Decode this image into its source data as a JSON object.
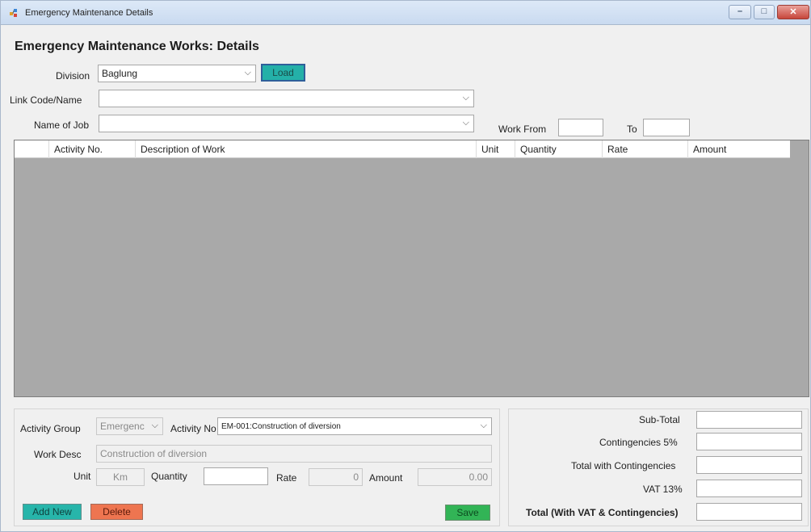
{
  "window": {
    "title": "Emergency Maintenance Details",
    "min_label": "–",
    "max_label": "□",
    "close_label": "✕"
  },
  "form": {
    "heading": "Emergency Maintenance Works: Details",
    "division_label": "Division",
    "division_value": "Baglung",
    "load_label": "Load",
    "link_label": "Link Code/Name",
    "link_value": "",
    "job_label": "Name of Job",
    "job_value": "",
    "work_from_label": "Work From",
    "work_from_value": "",
    "to_label": "To",
    "to_value": ""
  },
  "grid": {
    "columns": [
      "",
      "Activity No.",
      "Description of Work",
      "Unit",
      "Quantity",
      "Rate",
      "Amount"
    ]
  },
  "activity": {
    "group_label": "Activity Group",
    "group_value": "Emergenc",
    "activity_no_label": "Activity No",
    "activity_no_value": "EM-001:Construction of diversion",
    "work_desc_label": "Work Desc",
    "work_desc_value": "Construction of diversion",
    "unit_label": "Unit",
    "unit_value": "Km",
    "quantity_label": "Quantity",
    "quantity_value": "",
    "rate_label": "Rate",
    "rate_value": "0",
    "amount_label": "Amount",
    "amount_value": "0.00",
    "add_new_label": "Add New",
    "delete_label": "Delete",
    "save_label": "Save"
  },
  "totals": {
    "subtotal_label": "Sub-Total",
    "subtotal_value": "",
    "contingencies_label": "Contingencies 5%",
    "contingencies_value": "",
    "with_contingencies_label": "Total with Contingencies",
    "with_contingencies_value": "",
    "vat_label": "VAT 13%",
    "vat_value": "",
    "grand_total_label": "Total (With VAT & Contingencies)",
    "grand_total_value": ""
  },
  "icons": {
    "app": "app-icon",
    "dropdown": "chevron-down-icon"
  }
}
